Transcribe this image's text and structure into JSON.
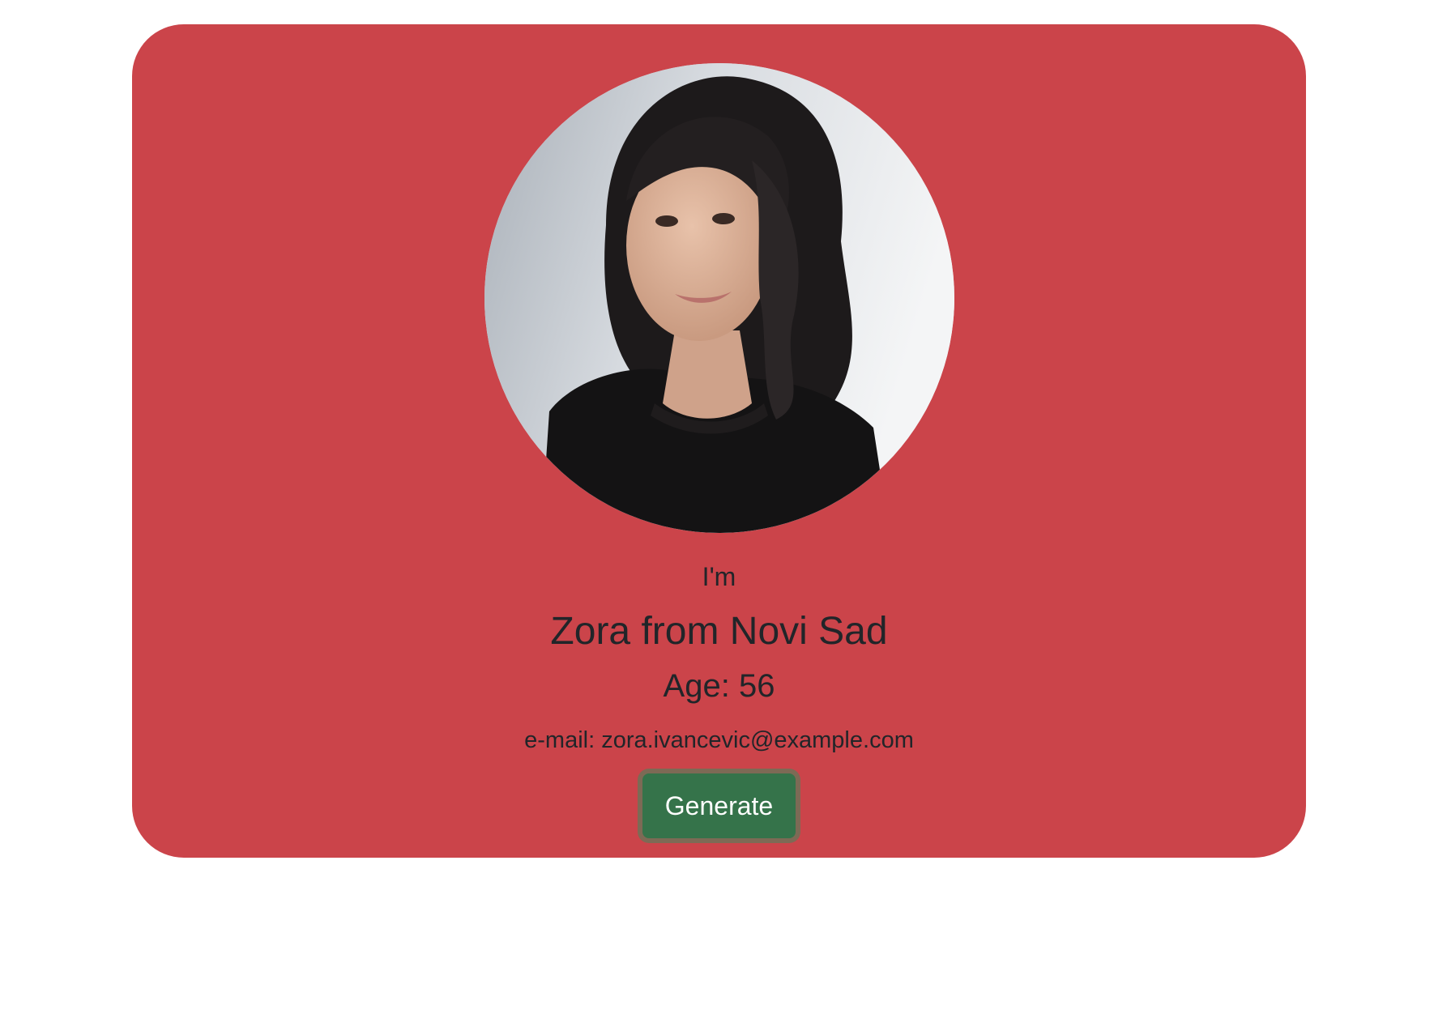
{
  "profile": {
    "intro": "I'm",
    "name_line": "Zora from Novi Sad",
    "age_line": "Age: 56",
    "email_line": "e-mail: zora.ivancevic@example.com",
    "photo_alt": "profile photo"
  },
  "actions": {
    "generate_label": "Generate"
  },
  "colors": {
    "card_background": "#cb444a",
    "button_background": "#35734a",
    "button_focus_ring": "#7d6a55",
    "text": "#212529"
  }
}
